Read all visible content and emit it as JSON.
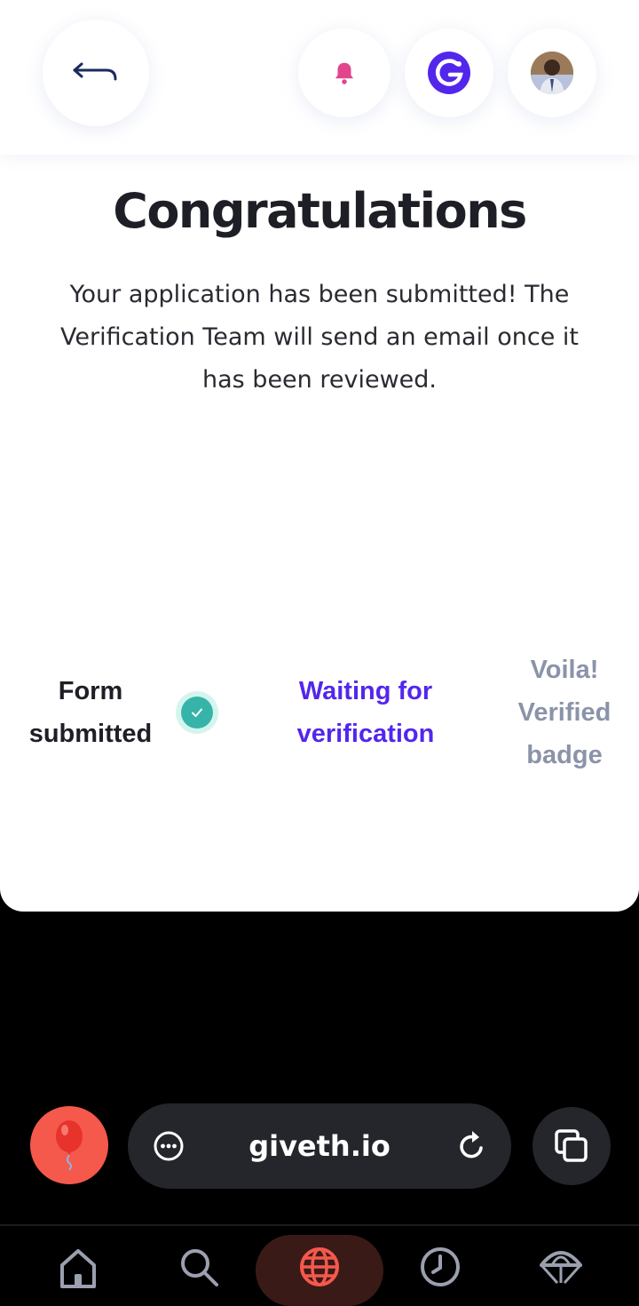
{
  "header": {
    "back_label": "Back",
    "notifications_label": "Notifications",
    "network_label": "Giveth",
    "profile_label": "Profile"
  },
  "main": {
    "title": "Congratulations",
    "message": "Your application has been submitted! The Verification Team will send an email once it has been reviewed.",
    "steps": [
      {
        "label": "Form submitted",
        "status": "done"
      },
      {
        "label": "Waiting for verification",
        "status": "active"
      },
      {
        "label": "Voila! Verified badge",
        "status": "pending"
      }
    ]
  },
  "browser": {
    "url": "giveth.io",
    "nav": [
      {
        "icon": "home-icon"
      },
      {
        "icon": "search-icon"
      },
      {
        "icon": "globe-icon",
        "active": true
      },
      {
        "icon": "history-icon"
      },
      {
        "icon": "parachute-icon"
      }
    ]
  },
  "colors": {
    "accent": "#5326ec",
    "success": "#37b4a9",
    "pending": "#8b93a9",
    "bell": "#e1458d",
    "browser_accent": "#f4594c"
  }
}
